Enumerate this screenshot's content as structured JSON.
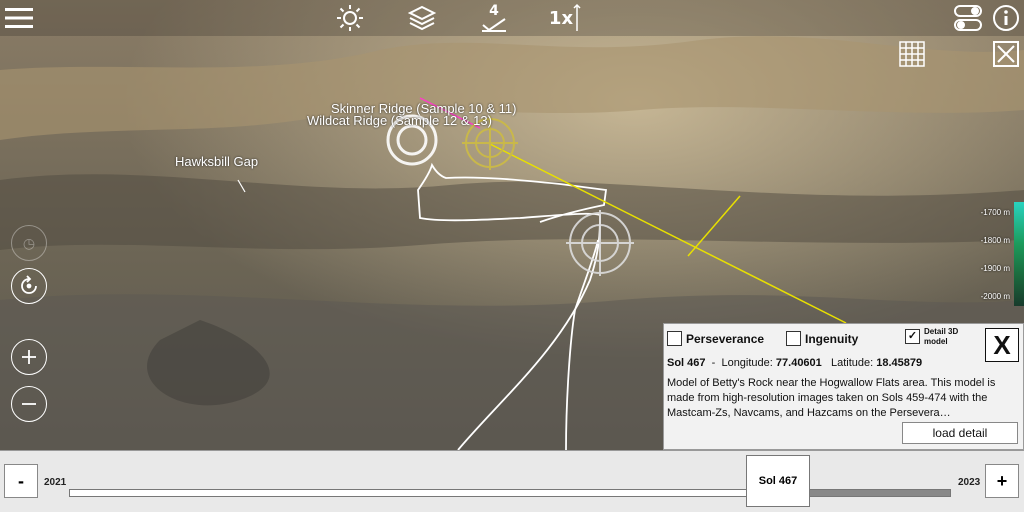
{
  "toolbar": {
    "menu_icon": "hamburger-menu-icon",
    "sun_icon": "sun-icon",
    "layers_icon": "layers-icon",
    "sol_step": "4",
    "zoom_level": "1x",
    "toggle_icon": "toggle-switch-icon",
    "info_icon": "info-icon"
  },
  "overlay_buttons": {
    "grid_icon": "grid-icon",
    "close_view_icon": "close-x-icon"
  },
  "map_labels": {
    "skinner": "Skinner Ridge (Sample 10 & 11)",
    "wildcat": "Wildcat Ridge (Sample 12 & 13)",
    "hawksbill": "Hawksbill Gap"
  },
  "elevation_scale": {
    "ticks": [
      "-1700 m",
      "-1800 m",
      "-1900 m",
      "-2000 m"
    ]
  },
  "panel": {
    "perseverance": "Perseverance",
    "ingenuity": "Ingenuity",
    "detail_model": "Detail 3D model",
    "perseverance_checked": false,
    "ingenuity_checked": false,
    "detail_checked": true,
    "close_label": "X",
    "sol": "Sol 467",
    "sep": "-",
    "longitude_label": "Longitude:",
    "longitude_value": "77.40601",
    "latitude_label": "Latitude:",
    "latitude_value": "18.45879",
    "description": "Model of Betty's Rock near the Hogwallow Flats area. This model is made from high-resolution images taken on Sols 459-474 with the Mastcam-Zs, Navcams, and Hazcams on the Persevera…",
    "load_button": "load detail"
  },
  "timeline": {
    "minus": "-",
    "plus": "+",
    "start_year": "2021",
    "end_year": "2023",
    "current": "Sol 467",
    "progress": 0.84
  },
  "colors": {
    "route": "#ffffff",
    "sightline": "#e8e000",
    "target": "#c9b84a",
    "pointer": "#ff3cc8"
  }
}
